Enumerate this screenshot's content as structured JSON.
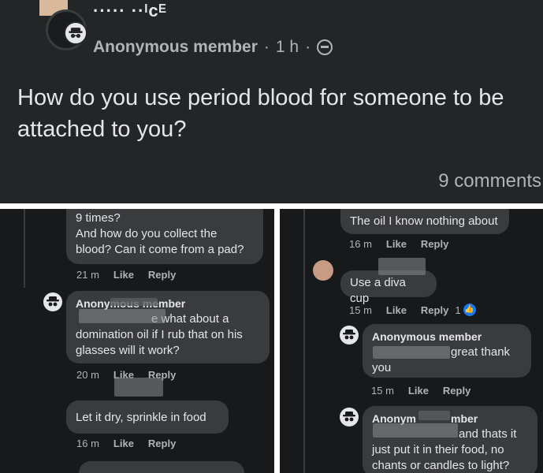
{
  "post": {
    "group_name": "····· ··ᴵᴄᴱ",
    "author": "Anonymous member",
    "time": "1 h",
    "separator": "·",
    "question": "How do you use period blood for someone to be attached to you?",
    "comment_count": "9 comments"
  },
  "left_panel": {
    "c1": {
      "text": "9 times?\nAnd how do you collect the blood? Can it come from a pad?",
      "line1": "9 times?",
      "line2": "And how do you collect the",
      "line3": "blood? Can it come from a pad?",
      "time": "21 m",
      "like": "Like",
      "reply": "Reply"
    },
    "c2": {
      "name": "Anonymous member",
      "line1": "e what about a",
      "line2": "domination oil if I rub that on his",
      "line3": "glasses will it work?",
      "time": "20 m",
      "like": "Like",
      "reply": "Reply"
    },
    "c3": {
      "text": "Let it dry, sprinkle in food",
      "time": "16 m",
      "like": "Like",
      "reply": "Reply"
    }
  },
  "right_panel": {
    "c1": {
      "text": "The oil I know nothing about",
      "time": "16 m",
      "like": "Like",
      "reply": "Reply"
    },
    "c2": {
      "text": "Use a diva cup",
      "time": "15 m",
      "like": "Like",
      "reply": "Reply",
      "reaction_count": "1"
    },
    "c3": {
      "name": "Anonymous member",
      "line1": "great thank",
      "line2": "you",
      "time": "15 m",
      "like": "Like",
      "reply": "Reply"
    },
    "c4": {
      "name_part1": "Anonym",
      "name_part2": "mber",
      "line1": "and thats it",
      "line2": "just put it in their food, no",
      "line3": "chants or candles to light?"
    }
  },
  "colors": {
    "post_bg": "#242526",
    "panel_bg": "#18191a",
    "bubble_bg": "#3a3b3c",
    "text": "#e4e6eb",
    "muted": "#b0b3b8",
    "like_blue": "#1877f2"
  },
  "icons": [
    "anonymous-icon",
    "globe-icon",
    "like-reaction-icon"
  ]
}
